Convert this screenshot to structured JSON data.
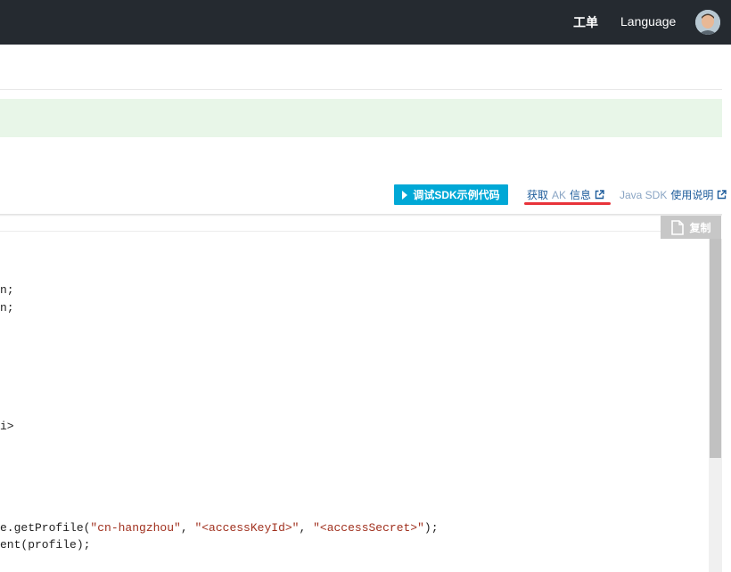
{
  "topbar": {
    "ticket_label": "工单",
    "language_label": "Language"
  },
  "toolbar": {
    "debug_button_label": "调试SDK示例代码",
    "ak_link": {
      "main": "获取",
      "light": "AK",
      "tail": "信息"
    },
    "java_link": {
      "light": "Java SDK",
      "main": "使用说明"
    },
    "copy_label": "复制"
  },
  "code": {
    "line1": "n;",
    "line2": "n;",
    "line3": "i>",
    "line4": {
      "prefix": "e.getProfile(",
      "arg1": "\"cn-hangzhou\"",
      "sep1": ", ",
      "arg2": "\"<accessKeyId>\"",
      "sep2": ", ",
      "arg3": "\"<accessSecret>\"",
      "suffix": ");"
    },
    "line5": "ent(profile);"
  },
  "colors": {
    "topbar": "#252a30",
    "notice": "#e8f6e8",
    "accent_button": "#00a8d6",
    "highlight_underline": "#e8333a",
    "link": "#1d5c9b"
  }
}
